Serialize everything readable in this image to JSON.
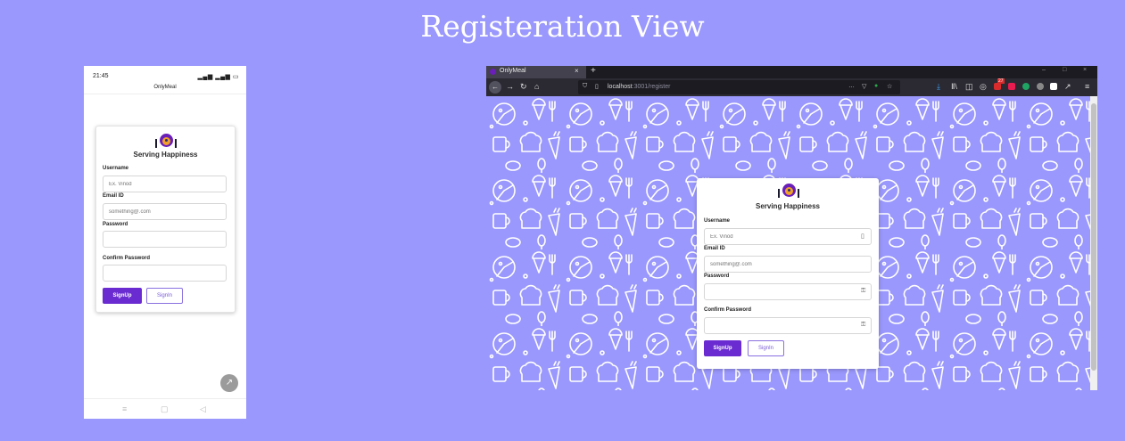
{
  "page_title": "Registeration View",
  "phone": {
    "status_time": "21:45",
    "status_icons": "‡ᴸ ᵗᴺᵉ ▁▃▅ ᵍ ▁▃▅ ▭ϟ",
    "app_title": "OnlyMeal",
    "nav": {
      "menu": "≡",
      "home": "▢",
      "back": "◁"
    },
    "fab_icon": "↗"
  },
  "form": {
    "brand": "Serving Happiness",
    "username_label": "Username",
    "username_placeholder": "Ex. Vinod",
    "email_label": "Email ID",
    "email_placeholder": "something@.com",
    "password_label": "Password",
    "confirm_password_label": "Confirm Password",
    "signup_label": "SignUp",
    "signin_label": "SignIn"
  },
  "browser": {
    "tab_title": "OnlyMeal",
    "tab_close": "×",
    "new_tab": "+",
    "url_host": "localhost",
    "url_path": ":3001/register",
    "window_controls": {
      "minimize": "–",
      "maximize": "□",
      "close": "×"
    },
    "nav_icons": {
      "back": "←",
      "forward": "→",
      "reload": "↻",
      "home": "⌂"
    },
    "url_icons": {
      "shield": "⛉",
      "page": "▯",
      "more": "…",
      "pocket": "▽",
      "star": "☆"
    },
    "toolbar_icons": {
      "download": "⤓",
      "library": "Ⅱ\\",
      "reader": "◫",
      "account": "◎",
      "menu": "≡",
      "pen": "↗"
    },
    "extension_badge": "27",
    "extension_colors": [
      "#d92b2b",
      "#e81c4f",
      "#1fa463",
      "#888888",
      "#ffffff"
    ]
  },
  "colors": {
    "page_background": "#9a98fc",
    "primary_button": "#6a2bd0",
    "logo_purple": "#6a1fb8",
    "logo_orange": "#f0a02a"
  }
}
